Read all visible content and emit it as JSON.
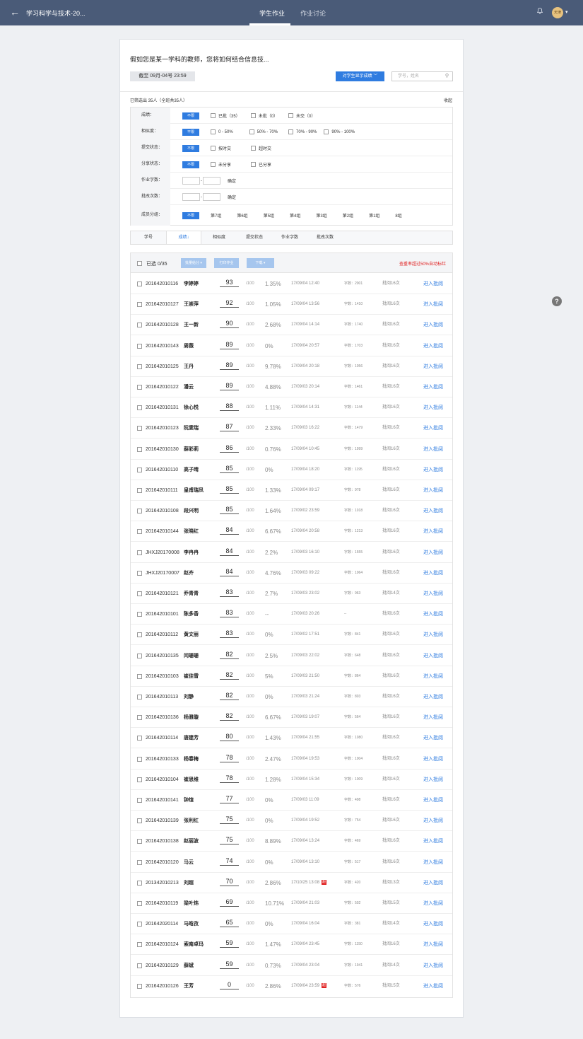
{
  "header": {
    "back_icon": "←",
    "title": "学习科学与技术-20...",
    "tabs": [
      {
        "label": "学生作业"
      },
      {
        "label": "作业讨论"
      }
    ],
    "bell_icon": "bell-icon",
    "avatar_text": "天津",
    "avatar_caret": "▾"
  },
  "assignment": {
    "title": "假如您是某一学科的教师，您将如何结合信息技...",
    "deadline": "截至  09月-04号 23:59",
    "show_button": "对学生显示成绩",
    "show_button_caret": "﹀",
    "search_placeholder": "学号，姓名",
    "search_icon": "⚲"
  },
  "filter": {
    "count_text": "已筛选出 35人（全班共35人）",
    "collapse": "收起",
    "all_label": "不限",
    "score_label": "成绩：",
    "score_opts": [
      "已批（35）",
      "未批（0）",
      "未交（0）"
    ],
    "sim_label": "相似度：",
    "sim_opts": [
      "0 - 50%",
      "50% - 70%",
      "70% - 90%",
      "90% - 100%"
    ],
    "submit_label": "提交状态：",
    "submit_opts": [
      "按时交",
      "超时交"
    ],
    "share_label": "分享状态：",
    "share_opts": [
      "未分享",
      "已分享"
    ],
    "words_label": "作业字数：",
    "rev_label": "批改次数：",
    "range_dash": "-",
    "confirm": "确定",
    "group_label": "成员分组：",
    "groups": [
      "第7组",
      "第6组",
      "第5组",
      "第4组",
      "第3组",
      "第2组",
      "第1组",
      "8组"
    ]
  },
  "sortbar": {
    "tabs": [
      "学号",
      "成绩↓",
      "相似度",
      "提交状态",
      "作业字数",
      "批改次数"
    ]
  },
  "table": {
    "selected": "已选 0/35",
    "batch_score": "批量给分 ▾",
    "print": "打印作业",
    "download": "下载 ▾",
    "warning": "查重率超过50%自动标红",
    "outof": "/100",
    "action": "进入批阅",
    "late_mark": "超",
    "rows": [
      {
        "id": "201642010116",
        "name": "李婷婷",
        "score": "93",
        "sim": "1.35%",
        "date": "17/09/04 12:40",
        "words": "字数：2001",
        "rev": "批阅16次"
      },
      {
        "id": "201642010127",
        "name": "王崇萍",
        "score": "92",
        "sim": "1.05%",
        "date": "17/09/04 13:56",
        "words": "字数：1410",
        "rev": "批阅16次"
      },
      {
        "id": "201642010128",
        "name": "王一新",
        "score": "90",
        "sim": "2.68%",
        "date": "17/09/04 14:14",
        "words": "字数：1740",
        "rev": "批阅16次"
      },
      {
        "id": "201642010143",
        "name": "周薇",
        "score": "89",
        "sim": "0%",
        "date": "17/09/04 20:57",
        "words": "字数：1703",
        "rev": "批阅16次"
      },
      {
        "id": "201642010125",
        "name": "王丹",
        "score": "89",
        "sim": "9.78%",
        "date": "17/09/04 20:18",
        "words": "字数：1056",
        "rev": "批阅16次"
      },
      {
        "id": "201642010122",
        "name": "潘云",
        "score": "89",
        "sim": "4.88%",
        "date": "17/09/03 20:14",
        "words": "字数：1461",
        "rev": "批阅16次"
      },
      {
        "id": "201642010131",
        "name": "徐心悦",
        "score": "88",
        "sim": "1.11%",
        "date": "17/09/04 14:31",
        "words": "字数：1144",
        "rev": "批阅16次"
      },
      {
        "id": "201642010123",
        "name": "阮雯瑞",
        "score": "87",
        "sim": "2.33%",
        "date": "17/09/03 16:22",
        "words": "字数：1479",
        "rev": "批阅16次"
      },
      {
        "id": "201642010130",
        "name": "薛彩莉",
        "score": "86",
        "sim": "0.76%",
        "date": "17/09/04 10:45",
        "words": "字数：1999",
        "rev": "批阅16次"
      },
      {
        "id": "201642010110",
        "name": "高子晴",
        "score": "85",
        "sim": "0%",
        "date": "17/09/04 18:20",
        "words": "字数：1195",
        "rev": "批阅16次"
      },
      {
        "id": "201642010111",
        "name": "皇甫瑞凤",
        "score": "85",
        "sim": "1.33%",
        "date": "17/09/04 09:17",
        "words": "字数：978",
        "rev": "批阅16次"
      },
      {
        "id": "201642010108",
        "name": "段兴明",
        "score": "85",
        "sim": "1.64%",
        "date": "17/09/02 23:59",
        "words": "字数：1018",
        "rev": "批阅16次"
      },
      {
        "id": "201642010144",
        "name": "张晓红",
        "score": "84",
        "sim": "6.67%",
        "date": "17/09/04 20:58",
        "words": "字数：1213",
        "rev": "批阅16次"
      },
      {
        "id": "JHXJ20170008",
        "name": "李冉冉",
        "score": "84",
        "sim": "2.2%",
        "date": "17/09/03 16:10",
        "words": "字数：1555",
        "rev": "批阅16次"
      },
      {
        "id": "JHXJ20170007",
        "name": "赵齐",
        "score": "84",
        "sim": "4.76%",
        "date": "17/09/03 09:22",
        "words": "字数：1064",
        "rev": "批阅16次"
      },
      {
        "id": "201642010121",
        "name": "乔青青",
        "score": "83",
        "sim": "2.7%",
        "date": "17/09/03 23:02",
        "words": "字数：963",
        "rev": "批阅14次"
      },
      {
        "id": "201642010101",
        "name": "陈多香",
        "score": "83",
        "sim": "--",
        "date": "17/09/03 20:26",
        "words": "--",
        "rev": "批阅16次"
      },
      {
        "id": "201642010112",
        "name": "黄文丽",
        "score": "83",
        "sim": "0%",
        "date": "17/09/02 17:51",
        "words": "字数：841",
        "rev": "批阅16次"
      },
      {
        "id": "201642010135",
        "name": "闫珊珊",
        "score": "82",
        "sim": "2.5%",
        "date": "17/09/03 22:02",
        "words": "字数：648",
        "rev": "批阅16次"
      },
      {
        "id": "201642010103",
        "name": "崔佳雪",
        "score": "82",
        "sim": "5%",
        "date": "17/09/03 21:50",
        "words": "字数：864",
        "rev": "批阅16次"
      },
      {
        "id": "201642010113",
        "name": "刘静",
        "score": "82",
        "sim": "0%",
        "date": "17/09/03 21:24",
        "words": "字数：803",
        "rev": "批阅16次"
      },
      {
        "id": "201642010136",
        "name": "杨雅璇",
        "score": "82",
        "sim": "6.67%",
        "date": "17/09/03 19:07",
        "words": "字数：564",
        "rev": "批阅16次"
      },
      {
        "id": "201642010114",
        "name": "唐建芳",
        "score": "80",
        "sim": "1.43%",
        "date": "17/09/04 21:55",
        "words": "字数：1080",
        "rev": "批阅16次"
      },
      {
        "id": "201642010133",
        "name": "杨春梅",
        "score": "78",
        "sim": "2.47%",
        "date": "17/09/04 19:53",
        "words": "字数：1004",
        "rev": "批阅16次"
      },
      {
        "id": "201642010104",
        "name": "崔思维",
        "score": "78",
        "sim": "1.28%",
        "date": "17/09/04 15:34",
        "words": "字数：1009",
        "rev": "批阅16次"
      },
      {
        "id": "201642010141",
        "name": "钟煊",
        "score": "77",
        "sim": "0%",
        "date": "17/09/03 11:09",
        "words": "字数：498",
        "rev": "批阅16次"
      },
      {
        "id": "201642010139",
        "name": "张利红",
        "score": "75",
        "sim": "0%",
        "date": "17/09/04 19:52",
        "words": "字数：754",
        "rev": "批阅16次"
      },
      {
        "id": "201642010138",
        "name": "赵丽波",
        "score": "75",
        "sim": "8.89%",
        "date": "17/09/04 13:24",
        "words": "字数：469",
        "rev": "批阅16次"
      },
      {
        "id": "201642010120",
        "name": "马云",
        "score": "74",
        "sim": "0%",
        "date": "17/09/04 13:10",
        "words": "字数：517",
        "rev": "批阅16次"
      },
      {
        "id": "201342010213",
        "name": "刘超",
        "score": "70",
        "sim": "2.86%",
        "date": "17/10/25 13:08",
        "words": "字数：420",
        "rev": "批阅13次",
        "late": true
      },
      {
        "id": "201642010119",
        "name": "梁叶炜",
        "score": "69",
        "sim": "10.71%",
        "date": "17/09/04 21:03",
        "words": "字数：502",
        "rev": "批阅15次"
      },
      {
        "id": "201642020114",
        "name": "马晗孜",
        "score": "65",
        "sim": "0%",
        "date": "17/09/04 16:04",
        "words": "字数：381",
        "rev": "批阅14次"
      },
      {
        "id": "201642010124",
        "name": "索南卓玛",
        "score": "59",
        "sim": "1.47%",
        "date": "17/09/04 23:45",
        "words": "字数：1150",
        "rev": "批阅16次"
      },
      {
        "id": "201642010129",
        "name": "薛斌",
        "score": "59",
        "sim": "0.73%",
        "date": "17/09/04 23:04",
        "words": "字数：1941",
        "rev": "批阅14次"
      },
      {
        "id": "201642010126",
        "name": "王芳",
        "score": "0",
        "sim": "2.86%",
        "date": "17/09/04 23:59",
        "words": "字数：576",
        "rev": "批阅15次",
        "late": true
      }
    ]
  },
  "help_label": "?"
}
